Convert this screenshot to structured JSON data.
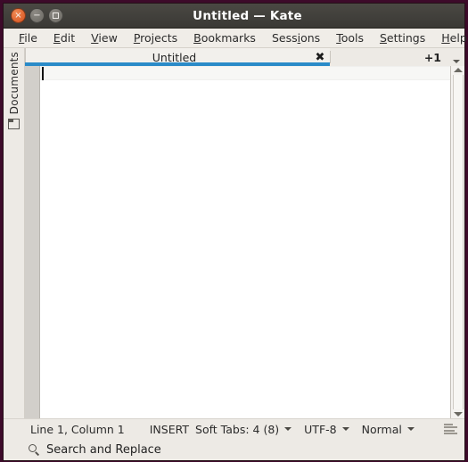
{
  "window": {
    "title": "Untitled — Kate",
    "controls": [
      {
        "name": "close",
        "glyph": "×"
      },
      {
        "name": "minimize",
        "glyph": "−"
      },
      {
        "name": "maximize",
        "glyph": ""
      }
    ]
  },
  "menubar": {
    "items": [
      {
        "label": "File",
        "pre": "",
        "mn": "F",
        "post": "ile"
      },
      {
        "label": "Edit",
        "pre": "",
        "mn": "E",
        "post": "dit"
      },
      {
        "label": "View",
        "pre": "",
        "mn": "V",
        "post": "iew"
      },
      {
        "label": "Projects",
        "pre": "",
        "mn": "P",
        "post": "rojects"
      },
      {
        "label": "Bookmarks",
        "pre": "",
        "mn": "B",
        "post": "ookmarks"
      },
      {
        "label": "Sessions",
        "pre": "Sess",
        "mn": "i",
        "post": "ons"
      },
      {
        "label": "Tools",
        "pre": "",
        "mn": "T",
        "post": "ools"
      },
      {
        "label": "Settings",
        "pre": "",
        "mn": "S",
        "post": "ettings"
      },
      {
        "label": "Help",
        "pre": "",
        "mn": "H",
        "post": "elp"
      }
    ]
  },
  "left_dock": {
    "label": "Documents",
    "icon": "folder-icon"
  },
  "tabbar": {
    "active_tab": "Untitled",
    "close_glyph": "✖",
    "overflow_count": "+1",
    "more_icon": "chevron-down-icon",
    "accent_color": "#2a8bc8"
  },
  "editor": {
    "content": "",
    "caret_line": 1,
    "caret_column": 1
  },
  "scrollbar": {
    "up_icon": "arrow-up-icon",
    "down_icon": "arrow-down-icon"
  },
  "statusbar": {
    "cursor_position": "Line 1, Column 1",
    "input_mode": "INSERT",
    "tab_settings": "Soft Tabs: 4 (8)",
    "encoding": "UTF-8",
    "highlight_mode": "Normal",
    "align_icon": "text-lines-icon"
  },
  "searchbar": {
    "icon": "search-icon",
    "label": "Search and Replace"
  }
}
